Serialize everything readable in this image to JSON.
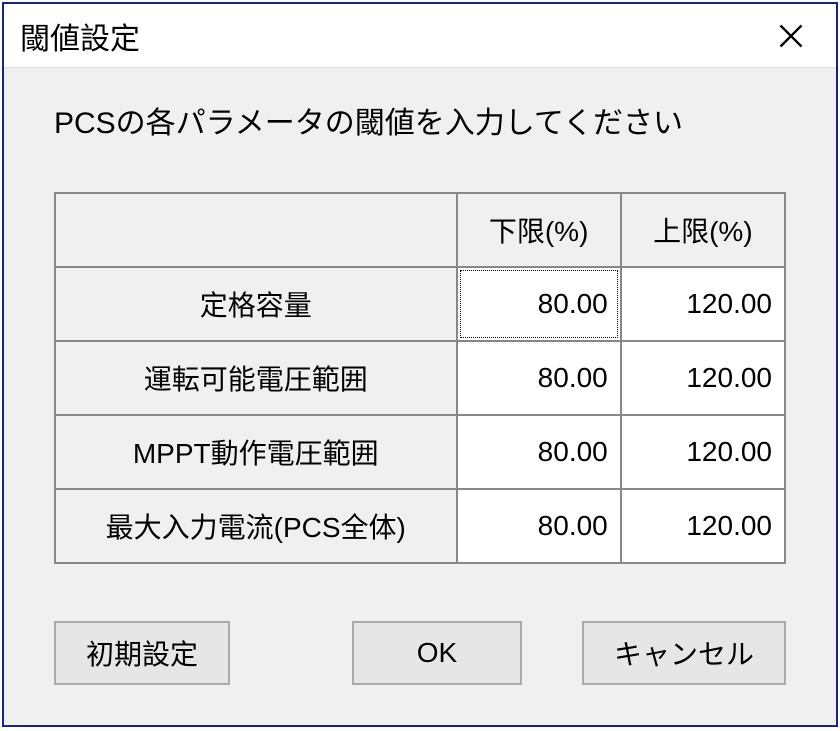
{
  "titlebar": {
    "title": "閾値設定"
  },
  "instruction": "PCSの各パラメータの閾値を入力してください",
  "table": {
    "headers": {
      "param": "",
      "lower": "下限(%)",
      "upper": "上限(%)"
    },
    "rows": [
      {
        "label": "定格容量",
        "lower": "80.00",
        "upper": "120.00"
      },
      {
        "label": "運転可能電圧範囲",
        "lower": "80.00",
        "upper": "120.00"
      },
      {
        "label": "MPPT動作電圧範囲",
        "lower": "80.00",
        "upper": "120.00"
      },
      {
        "label": "最大入力電流(PCS全体)",
        "lower": "80.00",
        "upper": "120.00"
      }
    ]
  },
  "buttons": {
    "reset": "初期設定",
    "ok": "OK",
    "cancel": "キャンセル"
  }
}
